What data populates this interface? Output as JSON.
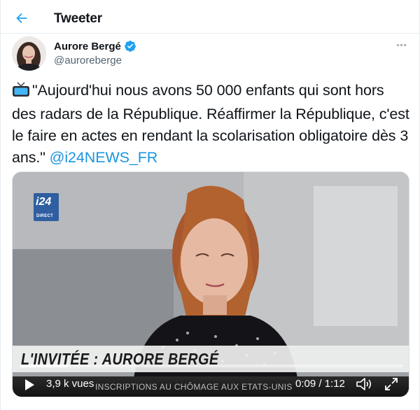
{
  "header": {
    "title": "Tweeter"
  },
  "author": {
    "display_name": "Aurore Bergé",
    "handle": "@auroreberge",
    "verified": true
  },
  "tweet": {
    "emoji": "tv-icon",
    "text": "\"Aujourd'hui nous avons 50 000 enfants qui sont hors des radars de la République. Réaffirmer la République, c'est le faire en actes en rendant la scolarisation obligatoire dès 3 ans.\"",
    "mention": "@i24NEWS_FR"
  },
  "video": {
    "channel_logo": "i24",
    "channel_sub": "DIRECT",
    "lower_third": "L'INVITÉE : AURORE BERGÉ",
    "ticker": "INSCRIPTIONS AU CHÔMAGE AUX ETATS-UNIS",
    "views": "3,9 k vues",
    "time": "0:09 / 1:12",
    "progress": 0.125
  },
  "colors": {
    "accent": "#1b95e0",
    "verified": "#1da1f2"
  }
}
